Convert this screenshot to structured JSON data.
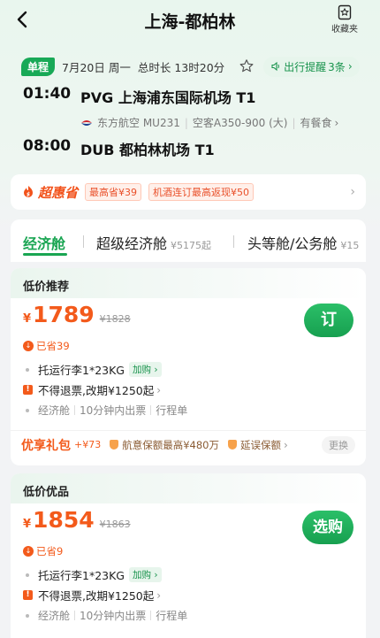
{
  "header": {
    "title": "上海-都柏林",
    "favorite_label": "收藏夹"
  },
  "trip": {
    "badge": "单程",
    "date": "7月20日 周一",
    "duration": "总时长 13时20分",
    "remind_label": "出行提醒",
    "remind_count": "3条"
  },
  "departure": {
    "time": "01:40",
    "airport": "PVG 上海浦东国际机场 T1"
  },
  "flight": {
    "airline": "东方航空 MU231",
    "aircraft": "空客A350-900 (大)",
    "meal": "有餐食"
  },
  "arrival": {
    "time": "08:00",
    "airport": "DUB 都柏林机场 T1"
  },
  "promo": {
    "brand": "超惠省",
    "tag1": "最高省¥39",
    "tag2": "机酒连订最高返现¥50"
  },
  "tabs": [
    {
      "label": "经济舱",
      "price": ""
    },
    {
      "label": "超级经济舱",
      "price": "¥5175起"
    },
    {
      "label": "头等舱/公务舱",
      "price": "¥15"
    }
  ],
  "fares": [
    {
      "title": "低价推荐",
      "currency": "¥",
      "price": "1789",
      "original": "¥1828",
      "saved": "已省39",
      "baggage": "托运行李1*23KG",
      "baggage_tag": "加购",
      "refund": "不得退票,改期¥1250起",
      "cabin": "经济舱",
      "ticketing": "10分钟内出票",
      "itinerary": "行程单",
      "button": "订",
      "gift_title": "优享礼包",
      "gift_add": "+¥73",
      "gift1": "航意保额最高¥480万",
      "gift2": "延误保额",
      "gift_change": "更换"
    },
    {
      "title": "低价优品",
      "currency": "¥",
      "price": "1854",
      "original": "¥1863",
      "saved": "已省9",
      "baggage": "托运行李1*23KG",
      "baggage_tag": "加购",
      "refund": "不得退票,改期¥1250起",
      "cabin": "经济舱",
      "ticketing": "10分钟内出票",
      "itinerary": "行程单",
      "button": "选购"
    }
  ],
  "colors": {
    "accent_green": "#19a552",
    "price_orange": "#f35a1b"
  }
}
